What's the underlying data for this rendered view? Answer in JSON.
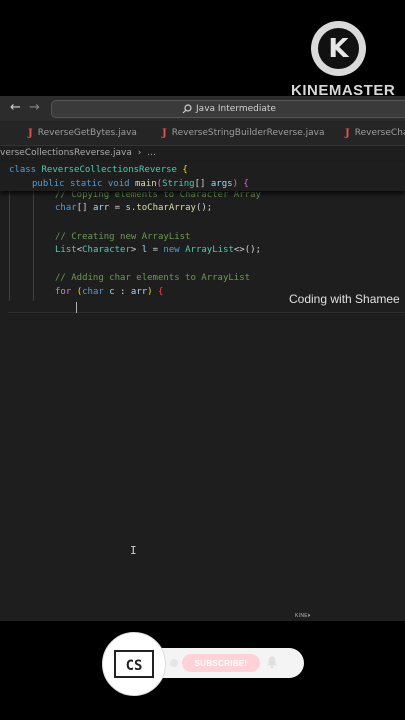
{
  "watermark": {
    "logo_letter": "K",
    "brand": "KINEMASTER",
    "mini": "KINE⏵"
  },
  "titlebar": {
    "search_text": "Java Intermediate",
    "back_arrow": "←",
    "forward_arrow": "→"
  },
  "tabs": [
    {
      "label": "ReverseGetBytes.java"
    },
    {
      "label": "ReverseStringBuilderReverse.java"
    },
    {
      "label": "ReverseCha"
    }
  ],
  "breadcrumb": {
    "file": "verseCollectionsReverse.java",
    "sep": "›",
    "more": "..."
  },
  "sticky": {
    "line1": {
      "kw": "class",
      "name": "ReverseCollectionsReverse",
      "brace": "{"
    },
    "line2": {
      "kw1": "public",
      "kw2": "static",
      "kw3": "void",
      "fn": "main",
      "p_open": "(",
      "ty": "String",
      "arr": "[]",
      "arg": "args",
      "p_close": ")",
      "brace": "{"
    }
  },
  "code": {
    "c1": "// Copying elements to Character Array",
    "l2": {
      "ty": "char",
      "arr": "[]",
      "v": "arr",
      "eq": " = ",
      "obj": "s",
      "dot": ".",
      "fn": "toCharArray",
      "call": "();"
    },
    "c3": "// Creating new ArrayList",
    "l4": {
      "ty": "List",
      "lt": "<",
      "gen": "Character",
      "gt": ">",
      "v": "l",
      "eq": " = ",
      "kw": "new",
      "ty2": "ArrayList",
      "diamond": "<>",
      "call": "();"
    },
    "c5": "// Adding char elements to ArrayList",
    "l6": {
      "kw": "for",
      "p_open": "(",
      "ty": "char",
      "v": "c",
      "colon": " : ",
      "v2": "arr",
      "p_close": ")",
      "brace": "{"
    }
  },
  "caption": "Coding with Shamee",
  "subscribe": {
    "label": "SUBSCRIBE!",
    "channel_logo": "CS"
  },
  "colors": {
    "editor_bg": "#1e1e1e",
    "keyword": "#569cd6",
    "type": "#4ec9b0",
    "comment": "#6a9955",
    "function": "#dcdcaa",
    "java_icon": "#e0524c"
  }
}
